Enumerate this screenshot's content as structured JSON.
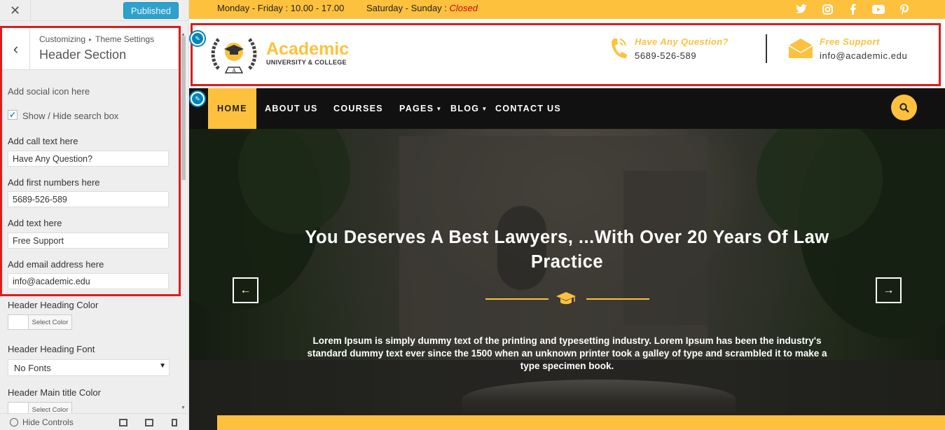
{
  "customizer": {
    "publish_label": "Published",
    "breadcrumb_root": "Customizing",
    "breadcrumb_child": "Theme Settings",
    "section_title": "Header Section",
    "social_icon_label": "Add social icon here",
    "search_toggle_label": "Show / Hide search box",
    "search_toggle_checked": true,
    "call_text_label": "Add call text here",
    "call_text_value": "Have Any Question?",
    "first_numbers_label": "Add first numbers here",
    "first_numbers_value": "5689-526-589",
    "text_label": "Add text here",
    "text_value": "Free Support",
    "email_label": "Add email address here",
    "email_value": "info@academic.edu",
    "heading_color_label": "Header Heading Color",
    "select_color_label": "Select Color",
    "heading_font_label": "Header Heading Font",
    "heading_font_value": "No Fonts",
    "main_title_color_label": "Header Main title Color",
    "hide_controls_label": "Hide Controls"
  },
  "site": {
    "hours_weekday": "Monday - Friday : 10.00 - 17.00",
    "hours_weekend_prefix": "Saturday - Sunday : ",
    "hours_weekend_status": "Closed",
    "brand_name": "Academic",
    "brand_sub": "UNIVERSITY & COLLEGE",
    "contact_title_1": "Have Any Question?",
    "contact_value_1": "5689-526-589",
    "contact_title_2": "Free Support",
    "contact_value_2": "info@academic.edu",
    "nav": [
      "HOME",
      "ABOUT US",
      "COURSES",
      "PAGES",
      "BLOG",
      "CONTACT US"
    ],
    "hero_title": "You Deserves A Best Lawyers, ...With Over 20 Years Of Law Practice",
    "hero_text": "Lorem Ipsum is simply dummy text of the printing and typesetting industry. Lorem Ipsum has been the industry's standard dummy text ever since the 1500 when an unknown printer took a galley of type and scrambled it to make a type specimen book.",
    "prev_arrow": "←",
    "next_arrow": "→"
  },
  "colors": {
    "accent": "#fdc13e",
    "highlight_border": "#e01b1b",
    "nav_bg": "#111111",
    "customizer_blue": "#0085ba"
  }
}
